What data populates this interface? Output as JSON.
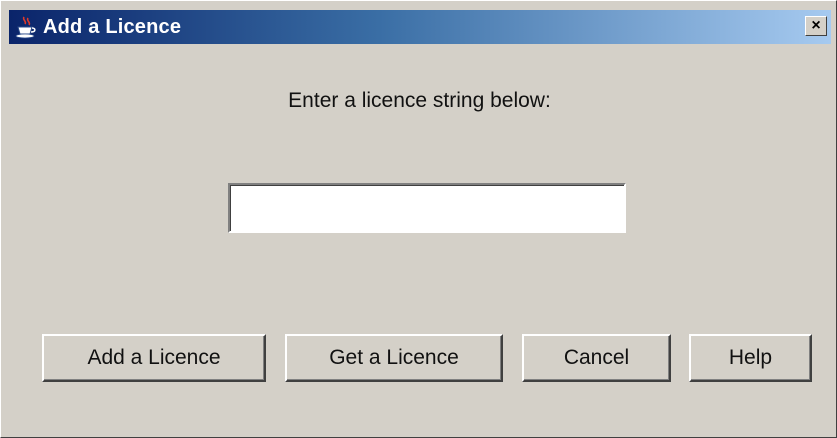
{
  "window": {
    "title": "Add a Licence",
    "title_icon": "java-coffee-cup-icon",
    "close_glyph": "×",
    "close_icon": "close-icon"
  },
  "dialog": {
    "prompt": "Enter a licence string below:",
    "licence_input": {
      "value": "",
      "placeholder": ""
    }
  },
  "buttons": {
    "add_label": "Add a Licence",
    "get_label": "Get a Licence",
    "cancel_label": "Cancel",
    "help_label": "Help"
  },
  "colors": {
    "face": "#d4d0c8",
    "titlebar_start": "#0a246a",
    "titlebar_end": "#a6caf0",
    "title_text": "#ffffff"
  }
}
